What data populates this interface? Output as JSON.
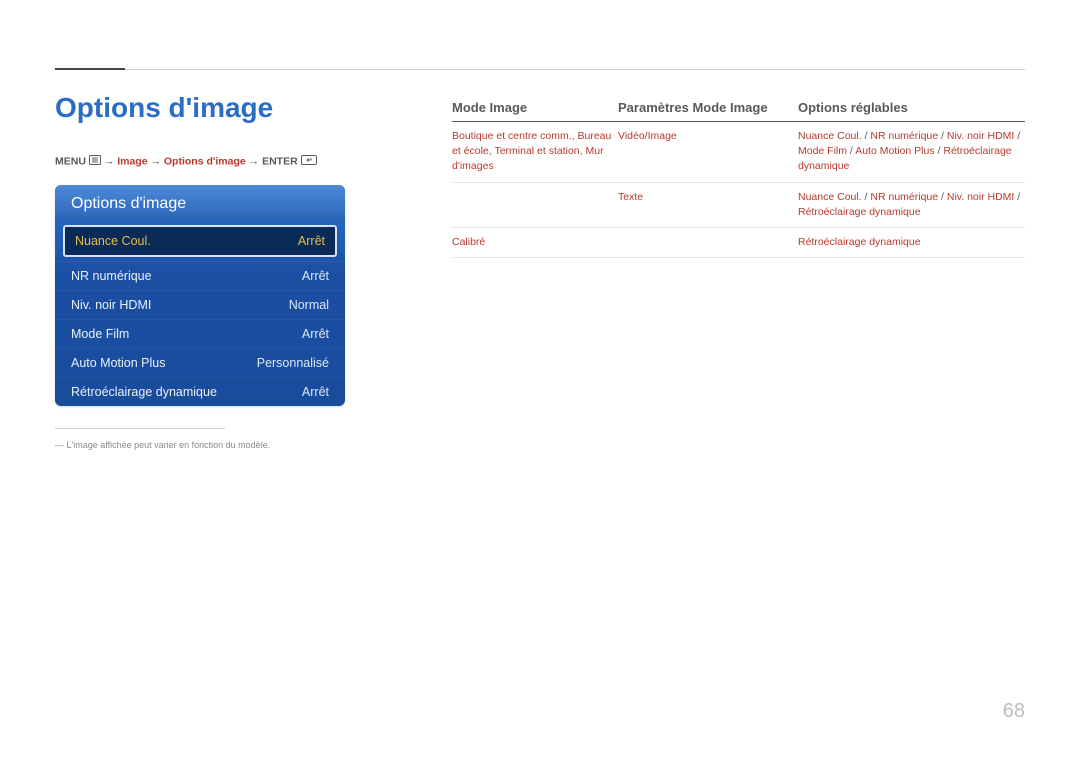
{
  "heading": "Options d'image",
  "breadcrumb": {
    "menu_label": "MENU",
    "arrow": "→",
    "p1": "Image",
    "p2": "Options d'image",
    "enter_label": "ENTER"
  },
  "panel": {
    "title": "Options d'image",
    "rows": [
      {
        "label": "Nuance Coul.",
        "value": "Arrêt",
        "selected": true
      },
      {
        "label": "NR numérique",
        "value": "Arrêt",
        "selected": false
      },
      {
        "label": "Niv. noir HDMI",
        "value": "Normal",
        "selected": false
      },
      {
        "label": "Mode Film",
        "value": "Arrêt",
        "selected": false
      },
      {
        "label": "Auto Motion Plus",
        "value": "Personnalisé",
        "selected": false
      },
      {
        "label": "Rétroéclairage dynamique",
        "value": "Arrêt",
        "selected": false
      }
    ]
  },
  "footnote_dash": "―",
  "footnote": "L'image affichée peut varier en fonction du modèle.",
  "table": {
    "headers": {
      "a": "Mode Image",
      "b": "Paramètres Mode Image",
      "c": "Options réglables"
    },
    "rows": [
      {
        "a_parts": [
          "Boutique et centre comm.",
          ", ",
          "Bureau et école",
          ", ",
          "Terminal et station",
          ", ",
          "Mur d'images"
        ],
        "b_parts": [
          "Vidéo/Image"
        ],
        "c_parts": [
          "Nuance Coul.",
          " / ",
          "NR numérique",
          " / ",
          "Niv. noir HDMI",
          " / ",
          "Mode Film",
          " / ",
          "Auto Motion Plus",
          " / ",
          "Rétroéclairage dynamique"
        ]
      },
      {
        "a_parts": [],
        "b_parts": [
          "Texte"
        ],
        "c_parts": [
          "Nuance Coul.",
          " / ",
          "NR numérique",
          " / ",
          "Niv. noir HDMI",
          " / ",
          "Rétroéclairage dynamique"
        ]
      },
      {
        "a_parts": [
          "Calibré"
        ],
        "b_parts": [],
        "c_parts": [
          "Rétroéclairage dynamique"
        ]
      }
    ]
  },
  "page_number": "68"
}
